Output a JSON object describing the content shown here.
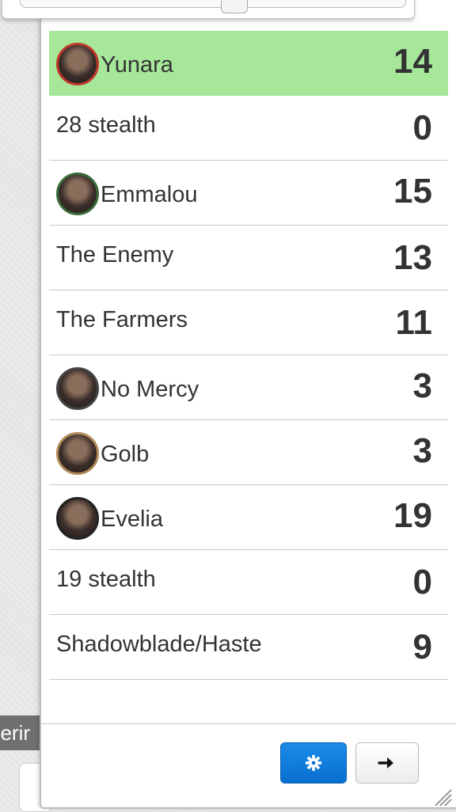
{
  "background": {
    "partial_label": "herir"
  },
  "turn_tracker": {
    "rows": [
      {
        "name": "Yunara",
        "initiative": "14",
        "avatar": "token-yunara",
        "active": true,
        "ring": "#c0392b"
      },
      {
        "name": "28 stealth",
        "initiative": "0",
        "avatar": null,
        "active": false
      },
      {
        "name": "Emmalou",
        "initiative": "15",
        "avatar": "token-emmalou",
        "active": false,
        "ring": "#3a6b3a"
      },
      {
        "name": "The Enemy",
        "initiative": "13",
        "avatar": null,
        "active": false
      },
      {
        "name": "The Farmers",
        "initiative": "11",
        "avatar": null,
        "active": false
      },
      {
        "name": "No Mercy",
        "initiative": "3",
        "avatar": "token-no-mercy",
        "active": false,
        "ring": "#444444"
      },
      {
        "name": "Golb",
        "initiative": "3",
        "avatar": "token-golb",
        "active": false,
        "ring": "#b08a58"
      },
      {
        "name": "Evelia",
        "initiative": "19",
        "avatar": "token-evelia",
        "active": false,
        "ring": "#222222"
      },
      {
        "name": "19 stealth",
        "initiative": "0",
        "avatar": null,
        "active": false
      },
      {
        "name": "Shadowblade/Haste",
        "initiative": "9",
        "avatar": null,
        "active": false
      }
    ],
    "buttons": {
      "settings_icon": "gear-icon",
      "next_icon": "arrow-right-icon"
    },
    "colors": {
      "active_row": "#a7e79a",
      "settings_button": "#0a6fd0"
    }
  }
}
